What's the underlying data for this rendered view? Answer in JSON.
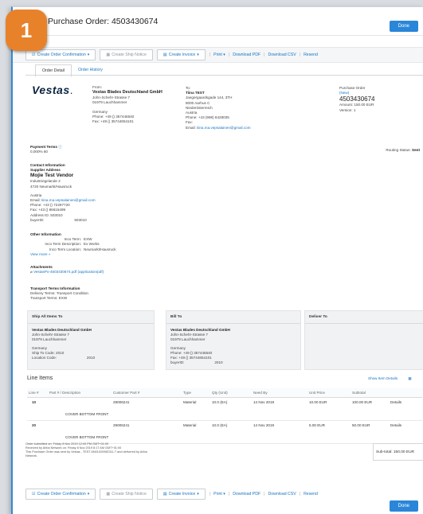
{
  "step_badge": "1",
  "title": "Purchase Order: 4503430674",
  "done_label": "Done",
  "toolbar": {
    "create_order_confirmation": "Create Order Confirmation",
    "create_ship_notice": "Create Ship Notice",
    "create_invoice": "Create Invoice",
    "print": "Print",
    "download_pdf": "Download PDF",
    "download_csv": "Download CSV",
    "resend": "Resend"
  },
  "tabs": {
    "order_detail": "Order Detail",
    "order_history": "Order History"
  },
  "logo_text": "Vestas",
  "from": {
    "label": "From:",
    "name": "Vestas Blades Deutschland GmbH",
    "street": "John-Schehr-Strasse 7",
    "city": "01979 Lauchhammer",
    "country": "Germany",
    "phone": "Phone: +49 () 357446540",
    "fax": "Fax: +49 () 35744654101"
  },
  "to": {
    "label": "To:",
    "name": "Tiina TEST",
    "street": "Jaegergaardsgade 144, 3TH",
    "city": "8000 Aarhus C",
    "region": "Niederösterreich",
    "country": "Austria",
    "phone": "Phone: +43 (998) 8428035",
    "fax": "Fax:",
    "email_label": "Email:",
    "email": "tiina.ma.vepsalainen@gmail.com"
  },
  "po": {
    "label": "Purchase Order",
    "status": "(New)",
    "number": "4503430674",
    "amount": "Amount: 150.00 EUR",
    "version": "Version: 1"
  },
  "payment_terms": {
    "label": "Payment Terms",
    "value": "0,000% 60"
  },
  "routing_status": {
    "label": "Routing Status:",
    "value": "Sent"
  },
  "contact": {
    "title": "Contact Information",
    "supplier_label": "Supplier Address",
    "vendor_name": "Mojie Test Vendor",
    "street": "Industriegelande 2",
    "city": "4720 Neumarkt/Hausruck",
    "country": "Austria",
    "email_label": "Email:",
    "email": "tiina.ma.vepsalainen@gmail.com",
    "phone": "Phone: +43 () 72297720",
    "fax": "Fax: +43 () 86615499",
    "address_id": "Address ID: 503010",
    "buyer_id_label": "buyerID:",
    "buyer_id": "503010"
  },
  "other": {
    "title": "Other Information",
    "rows": [
      {
        "label": "Inco Term:",
        "value": "EXW"
      },
      {
        "label": "Inco Term Description:",
        "value": "Ex Works"
      },
      {
        "label": "Inco Term Location:",
        "value": "Neumarkt/Hausruck"
      }
    ],
    "view_more": "View more »"
  },
  "attachments": {
    "title": "Attachments",
    "file": "VestasPo-4503430674.pdf (application/pdf)"
  },
  "transport": {
    "title": "Transport Terms Information",
    "delivery": "Delivery Terms: Transport Condition",
    "transport": "Transport Terms: EXW"
  },
  "ship_to": {
    "header": "Ship All Items To",
    "name": "Vestas Blades Deutschland GmbH",
    "street": "John-Schehr-Strasse 7",
    "city": "01979 Lauchhammer",
    "country": "Germany",
    "code": "Ship To Code: 2010",
    "location_label": "Location Code:",
    "location": "2010"
  },
  "bill_to": {
    "header": "Bill To",
    "name": "Vestas Blades Deutschland GmbH",
    "street": "John-Schehr-Strasse 7",
    "city": "01979 Lauchhammer",
    "country": "Germany",
    "phone": "Phone: +49 () 357446540",
    "fax": "Fax: +49 () 35744654101",
    "buyer_label": "buyerID:",
    "buyer": "2010"
  },
  "deliver_to": {
    "header": "Deliver To"
  },
  "line_items": {
    "title": "Line Items",
    "show_details": "Show Item Details",
    "columns": [
      "Line #",
      "Part # / Description",
      "Customer Part #",
      "Type",
      "Qty (Unit)",
      "Need By",
      "Unit Price",
      "Subtotal",
      ""
    ],
    "rows": [
      {
        "line": "10",
        "part": "",
        "customer_part": "29006241",
        "type": "Material",
        "qty": "10.0 (EA)",
        "need_by": "14 Nov 2019",
        "unit_price": "10.00 EUR",
        "subtotal": "100.00 EUR",
        "details": "Details",
        "description": "COVER BOTTOM FRONT"
      },
      {
        "line": "20",
        "part": "",
        "customer_part": "29006241",
        "type": "Material",
        "qty": "10.0 (EA)",
        "need_by": "14 Nov 2019",
        "unit_price": "5.00 EUR",
        "subtotal": "50.00 EUR",
        "details": "Details",
        "description": "COVER BOTTOM FRONT"
      }
    ]
  },
  "footnotes": [
    "Order submitted on: Friday 8 Nov 2019 12:00 PM GMT+01:00",
    "Received by Ariba Network on: Friday 8 Nov 2019 8:17 AM GMT+01:00",
    "This Purchase Order was sent by Vestas - TEST AN01020982311-T and delivered by Ariba",
    "Network."
  ],
  "subtotal": {
    "label": "Sub-total:",
    "value": "150.00 EUR"
  }
}
